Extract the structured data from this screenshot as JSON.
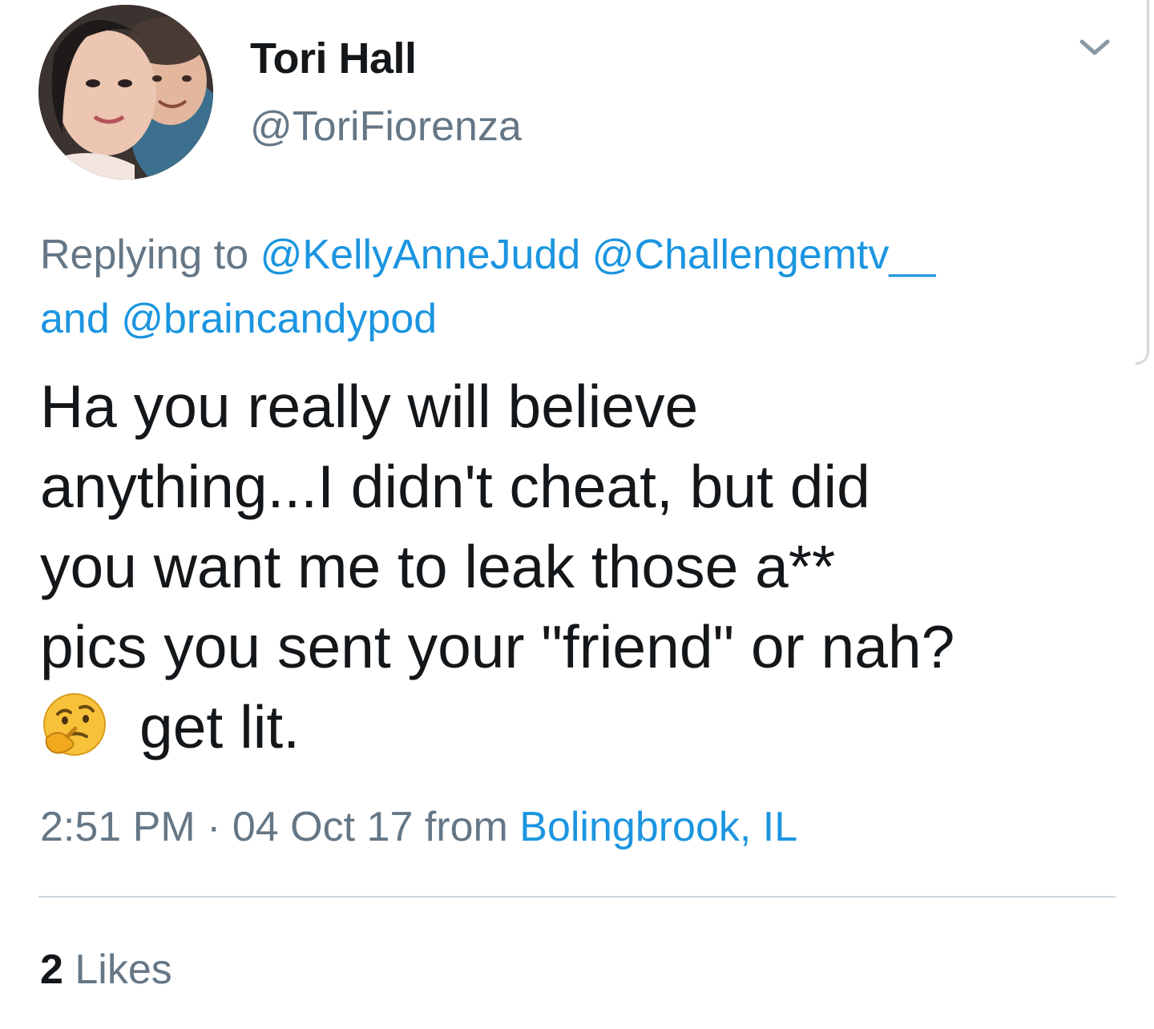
{
  "tweet": {
    "author": {
      "display_name": "Tori Hall",
      "handle": "@ToriFiorenza"
    },
    "reply_context": {
      "prefix": "Replying to",
      "mentions": [
        "@KellyAnneJudd",
        "@Challengemtv__"
      ],
      "joiner": "and",
      "last_mention": "@braincandypod"
    },
    "text_line_1": "Ha you really will believe",
    "text_line_2": "anything...I didn't cheat, but did",
    "text_line_3": "you want me to leak those a**",
    "text_line_4": "pics you sent your \"friend\" or nah?",
    "text_line_5": "get lit.",
    "emoji": "thinking-face-icon",
    "time": "2:51 PM",
    "separator": "·",
    "date": "04 Oct 17",
    "from_label": "from",
    "location": "Bolingbrook, IL",
    "likes_count": "2",
    "likes_label": "Likes"
  },
  "colors": {
    "link": "#1b95e0",
    "secondary_text": "#657786",
    "primary_text": "#14171a",
    "divider": "#ccd6dd"
  }
}
